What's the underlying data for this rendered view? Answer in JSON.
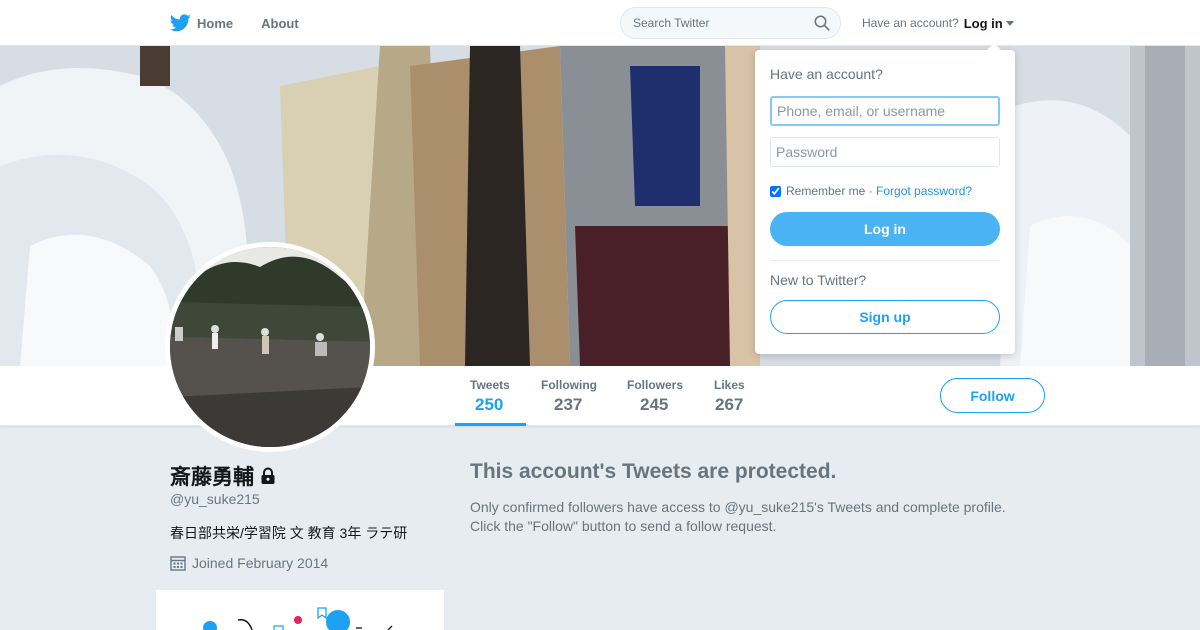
{
  "nav": {
    "home_label": "Home",
    "about_label": "About",
    "search_placeholder": "Search Twitter",
    "have_account": "Have an account?",
    "login_label": "Log in"
  },
  "login_dropdown": {
    "title": "Have an account?",
    "username_placeholder": "Phone, email, or username",
    "password_placeholder": "Password",
    "remember_label": "Remember me",
    "separator": " · ",
    "forgot_label": "Forgot password?",
    "login_button": "Log in",
    "new_label": "New to Twitter?",
    "signup_button": "Sign up"
  },
  "stats": [
    {
      "label": "Tweets",
      "value": "250"
    },
    {
      "label": "Following",
      "value": "237"
    },
    {
      "label": "Followers",
      "value": "245"
    },
    {
      "label": "Likes",
      "value": "267"
    }
  ],
  "follow_button": "Follow",
  "profile": {
    "name": "斎藤勇輔",
    "handle": "@yu_suke215",
    "bio": "春日部共栄/学習院 文 教育 3年 ラテ研",
    "joined": "Joined February 2014"
  },
  "protected": {
    "title": "This account's Tweets are protected.",
    "description": "Only confirmed followers have access to @yu_suke215's Tweets and complete profile. Click the \"Follow\" button to send a follow request."
  },
  "colors": {
    "accent": "#1da1f2",
    "background": "#e6ecf0",
    "muted_text": "#66757f"
  },
  "icons": [
    "twitter-bird-icon",
    "home-nav",
    "search-icon",
    "caret-down-icon",
    "lock-icon",
    "calendar-icon"
  ]
}
